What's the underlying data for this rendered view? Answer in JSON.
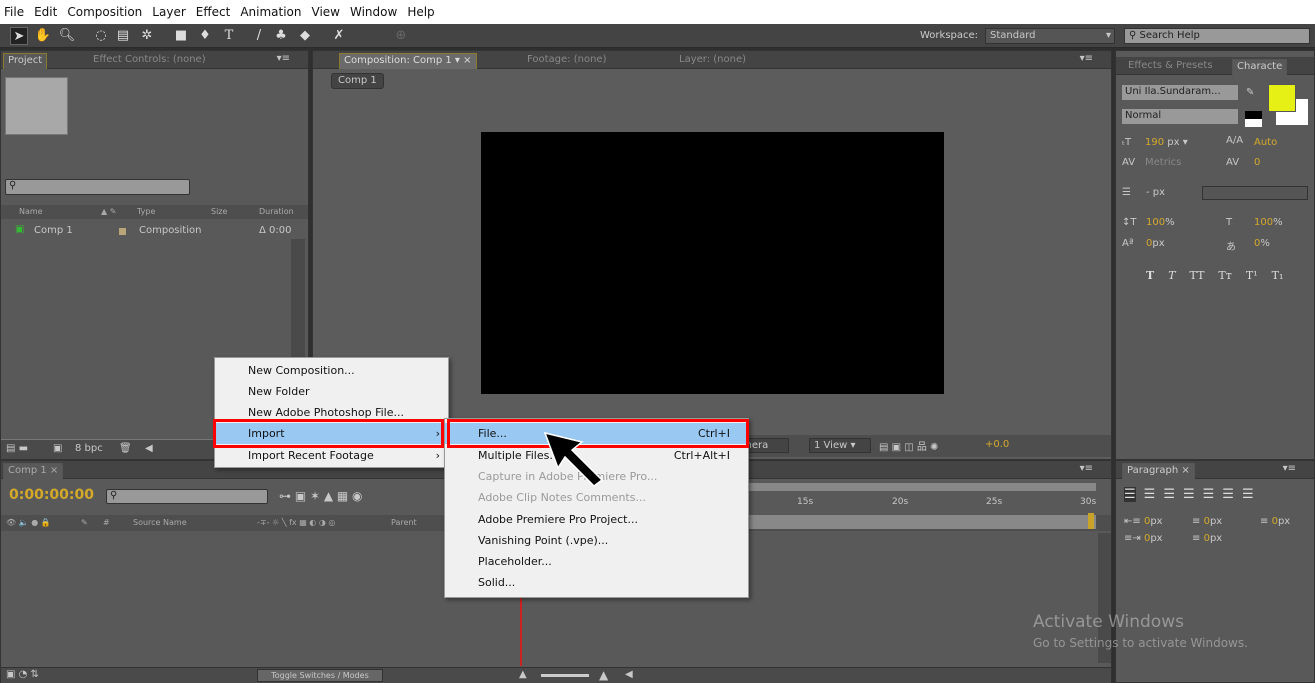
{
  "menubar": [
    "File",
    "Edit",
    "Composition",
    "Layer",
    "Effect",
    "Animation",
    "View",
    "Window",
    "Help"
  ],
  "toolbar": {
    "workspace_label": "Workspace:",
    "workspace_value": "Standard",
    "search_placeholder": "Search Help"
  },
  "project": {
    "tab": "Project",
    "tab2": "Effect Controls: (none)",
    "columns": [
      "Name",
      "Type",
      "Size",
      "Duration"
    ],
    "rows": [
      {
        "name": "Comp 1",
        "type": "Composition",
        "duration": "Δ 0:00"
      }
    ],
    "bpc": "8 bpc"
  },
  "composition": {
    "tab": "Composition: Comp 1",
    "tab2": "Footage: (none)",
    "tab3": "Layer: (none)",
    "breadcrumb": "Comp 1",
    "camera": "amera",
    "views": "1 View",
    "exposure": "+0.0"
  },
  "character": {
    "tab1": "Effects & Presets",
    "tab2": "Characte",
    "font": "Uni Ila.Sundaram...",
    "style": "Normal",
    "fill_color": "#e6f014",
    "size": "190",
    "size_unit": "px",
    "leading": "Auto",
    "kerning": "Metrics",
    "tracking": "0",
    "line_px": "- px",
    "vscale": "100",
    "vscale_unit": "%",
    "hscale": "100",
    "hscale_unit": "%",
    "baseline": "0",
    "baseline_unit": "px",
    "tsume": "0",
    "tsume_unit": "%",
    "styles": [
      "T",
      "T",
      "TT",
      "Tт",
      "T¹",
      "T₁"
    ]
  },
  "timeline": {
    "tab": "Comp 1",
    "timecode": "0:00:00:00",
    "col_source": "Source Name",
    "col_parent": "Parent",
    "col_num": "#",
    "ruler": [
      "15s",
      "20s",
      "25s",
      "30s"
    ],
    "toggle": "Toggle Switches / Modes"
  },
  "paragraph": {
    "tab": "Paragraph",
    "values": [
      "0",
      "0",
      "0",
      "0",
      "0"
    ],
    "unit": "px"
  },
  "context_menu": {
    "items": [
      {
        "label": "New Composition..."
      },
      {
        "label": "New Folder"
      },
      {
        "label": "New Adobe Photoshop File..."
      },
      {
        "label": "Import",
        "highlighted": true,
        "submenu": true
      },
      {
        "label": "Import Recent Footage",
        "submenu": true
      }
    ]
  },
  "import_submenu": {
    "items": [
      {
        "label": "File...",
        "shortcut": "Ctrl+I",
        "highlighted": true
      },
      {
        "label": "Multiple Files...",
        "shortcut": "Ctrl+Alt+I"
      },
      {
        "label": "Capture in Adobe Premiere Pro...",
        "disabled": true
      },
      {
        "label": "Adobe Clip Notes Comments...",
        "disabled": true
      },
      {
        "label": "Adobe Premiere Pro Project..."
      },
      {
        "label": "Vanishing Point (.vpe)..."
      },
      {
        "label": "Placeholder..."
      },
      {
        "label": "Solid..."
      }
    ]
  },
  "watermark": {
    "title": "Activate Windows",
    "subtitle": "Go to Settings to activate Windows."
  }
}
